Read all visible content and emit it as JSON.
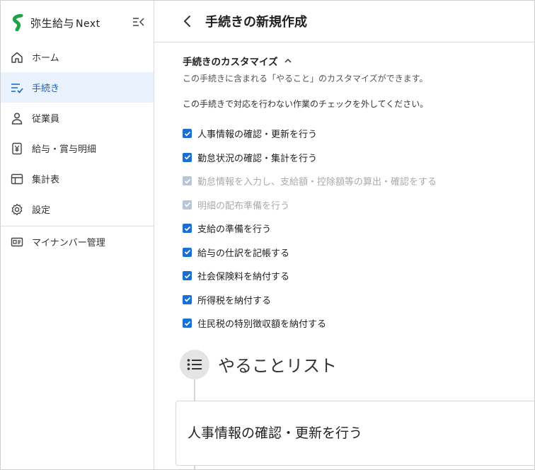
{
  "app": {
    "name": "弥生給与",
    "suffix": "Next"
  },
  "nav": {
    "items": [
      {
        "label": "ホーム",
        "icon": "home-icon"
      },
      {
        "label": "手続き",
        "icon": "task-list-icon",
        "active": true
      },
      {
        "label": "従業員",
        "icon": "person-icon"
      },
      {
        "label": "給与・賞与明細",
        "icon": "yen-document-icon"
      },
      {
        "label": "集計表",
        "icon": "table-icon"
      },
      {
        "label": "設定",
        "icon": "gear-icon"
      }
    ],
    "extra": [
      {
        "label": "マイナンバー管理",
        "icon": "id-card-icon"
      }
    ]
  },
  "header": {
    "title": "手続きの新規作成"
  },
  "customize": {
    "title": "手続きのカスタマイズ",
    "description": "この手続きに含まれる「やること」のカスタマイズができます。",
    "instruction": "この手続きで対応を行わない作業のチェックを外してください。",
    "items": [
      {
        "label": "人事情報の確認・更新を行う",
        "checked": true,
        "disabled": false
      },
      {
        "label": "勤怠状況の確認・集計を行う",
        "checked": true,
        "disabled": false
      },
      {
        "label": "勤怠情報を入力し、支給額・控除額等の算出・確認をする",
        "checked": true,
        "disabled": true
      },
      {
        "label": "明細の配布準備を行う",
        "checked": true,
        "disabled": true
      },
      {
        "label": "支給の準備を行う",
        "checked": true,
        "disabled": false
      },
      {
        "label": "給与の仕訳を記帳する",
        "checked": true,
        "disabled": false
      },
      {
        "label": "社会保険料を納付する",
        "checked": true,
        "disabled": false
      },
      {
        "label": "所得税を納付する",
        "checked": true,
        "disabled": false
      },
      {
        "label": "住民税の特別徴収額を納付する",
        "checked": true,
        "disabled": false
      }
    ]
  },
  "todo": {
    "title": "やることリスト",
    "cards": [
      {
        "title": "人事情報の確認・更新を行う"
      }
    ]
  },
  "colors": {
    "accent": "#1a6fd0",
    "active_bg": "#eaf3fd",
    "brand": "#1fa24a"
  }
}
